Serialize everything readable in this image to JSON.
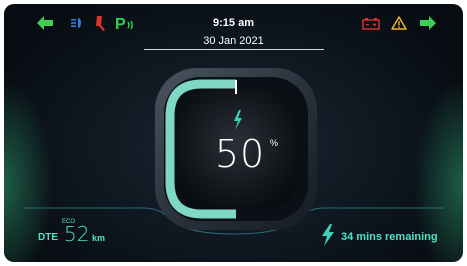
{
  "status_bar": {
    "time": "9:15 am",
    "date": "30 Jan 2021",
    "left_indicators": [
      "left-turn-indicator",
      "headlight-beam-indicator",
      "side-stand-indicator",
      "parking-indicator"
    ],
    "right_indicators": [
      "battery-warning-indicator",
      "general-warning-indicator",
      "right-turn-indicator"
    ]
  },
  "charge": {
    "percent_value": "50",
    "percent_unit": "%",
    "level": 0.5,
    "status_icon": "lightning-bolt-icon"
  },
  "range": {
    "label": "DTE",
    "mode": "ECO",
    "value": "52",
    "unit": "km"
  },
  "charging": {
    "remaining_text": "34 mins remaining"
  },
  "colors": {
    "accent_teal": "#4fe3c6",
    "arrow_green": "#3fcf55",
    "parking_green": "#2fd34a",
    "warning_red": "#e0322b",
    "headlight_blue": "#2b7de0"
  }
}
